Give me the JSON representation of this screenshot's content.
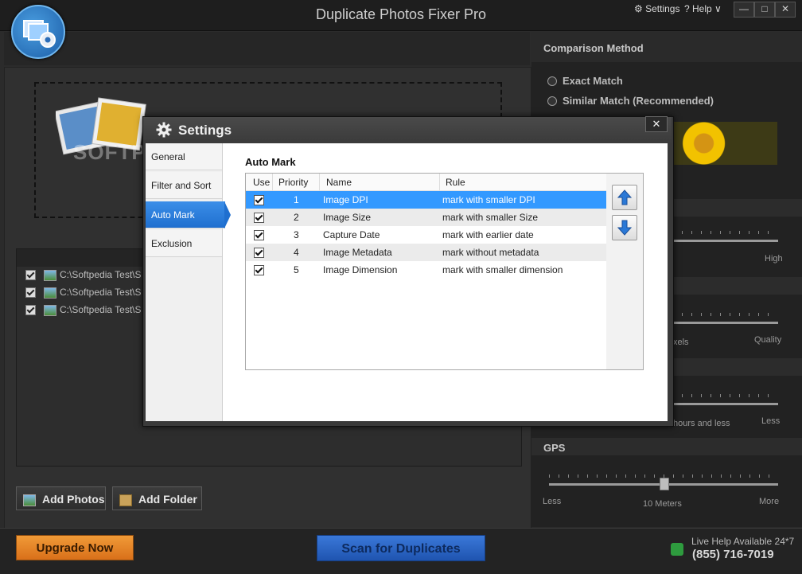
{
  "app": {
    "title": "Duplicate Photos Fixer Pro",
    "menu_settings": "⚙ Settings",
    "menu_help": "? Help ∨",
    "win_minimize": "—",
    "win_maximize": "□",
    "win_close": "✕"
  },
  "main": {
    "watermark": "SOFTPEDIA",
    "files": [
      {
        "path": "C:\\Softpedia Test\\S",
        "checked": true
      },
      {
        "path": "C:\\Softpedia Test\\S",
        "checked": true
      },
      {
        "path": "C:\\Softpedia Test\\S",
        "checked": true
      }
    ],
    "add_photos_label": "Add Photos",
    "add_folder_label": "Add Folder"
  },
  "footer": {
    "upgrade_label": "Upgrade Now",
    "scan_label": "Scan for Duplicates",
    "live_help": "Live Help Available 24*7",
    "phone": "(855) 716-7019"
  },
  "right_panel": {
    "comparison_heading": "Comparison Method",
    "exact_match": "Exact Match",
    "similar_match": "Similar Match (Recommended)",
    "slider1_right": "High",
    "slider2_left": "xels",
    "slider2_right": "Quality",
    "slider3_left": "hours and less",
    "slider3_right": "Less",
    "gps_heading": "GPS",
    "gps_left": "Less",
    "gps_mid": "10 Meters",
    "gps_right": "More"
  },
  "dialog": {
    "title": "Settings",
    "close": "✕",
    "nav": [
      "General",
      "Filter and Sort",
      "Auto Mark",
      "Exclusion"
    ],
    "active_nav": "Auto Mark",
    "section_title": "Auto Mark",
    "columns": {
      "use": "Use",
      "priority": "Priority",
      "name": "Name",
      "rule": "Rule"
    },
    "rows": [
      {
        "priority": "1",
        "name": "Image DPI",
        "rule": "mark with smaller DPI",
        "checked": true
      },
      {
        "priority": "2",
        "name": "Image Size",
        "rule": "mark with smaller Size",
        "checked": true
      },
      {
        "priority": "3",
        "name": "Capture Date",
        "rule": "mark with earlier date",
        "checked": true
      },
      {
        "priority": "4",
        "name": "Image Metadata",
        "rule": "mark without metadata",
        "checked": true
      },
      {
        "priority": "5",
        "name": "Image Dimension",
        "rule": "mark with smaller dimension",
        "checked": true
      }
    ],
    "move_up_icon": "arrow-up-icon",
    "move_down_icon": "arrow-down-icon"
  },
  "colors": {
    "accent_blue": "#1f6fcf",
    "upgrade_orange": "#e8862a",
    "scan_blue": "#2a64c4",
    "selected_row": "#3399ff"
  }
}
